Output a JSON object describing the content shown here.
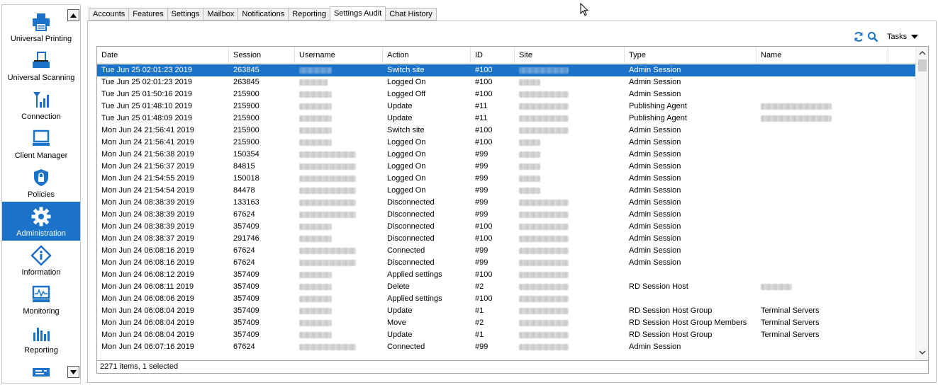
{
  "sidebar": {
    "items": [
      {
        "label": "Universal Printing",
        "icon": "printer-icon",
        "active": false
      },
      {
        "label": "Universal Scanning",
        "icon": "scanner-icon",
        "active": false
      },
      {
        "label": "Connection",
        "icon": "signal-icon",
        "active": false
      },
      {
        "label": "Client Manager",
        "icon": "monitor-icon",
        "active": false
      },
      {
        "label": "Policies",
        "icon": "shield-lock-icon",
        "active": false
      },
      {
        "label": "Administration",
        "icon": "gear-icon",
        "active": true
      },
      {
        "label": "Information",
        "icon": "info-diamond-icon",
        "active": false
      },
      {
        "label": "Monitoring",
        "icon": "monitoring-chart-icon",
        "active": false
      },
      {
        "label": "Reporting",
        "icon": "bar-chart-icon",
        "active": false
      }
    ],
    "accent": "#1a73c9",
    "icon_color": "#1a73c9"
  },
  "tabs": [
    {
      "label": "Accounts"
    },
    {
      "label": "Features"
    },
    {
      "label": "Settings"
    },
    {
      "label": "Mailbox"
    },
    {
      "label": "Notifications"
    },
    {
      "label": "Reporting"
    },
    {
      "label": "Settings Audit",
      "active": true
    },
    {
      "label": "Chat History"
    }
  ],
  "toolbar": {
    "refresh_icon": "refresh-icon",
    "search_icon": "search-icon",
    "tasks_label": "Tasks"
  },
  "grid": {
    "columns": [
      "Date",
      "Session",
      "Username",
      "Action",
      "ID",
      "Site",
      "Type",
      "Name"
    ],
    "rows": [
      {
        "date": "Tue Jun 25 02:01:23 2019",
        "session": "263845",
        "action": "Switch site",
        "id": "#100",
        "type": "Admin Session",
        "name": "",
        "selected": true
      },
      {
        "date": "Tue Jun 25 02:01:23 2019",
        "session": "263845",
        "action": "Logged On",
        "id": "#100",
        "type": "Admin Session",
        "name": ""
      },
      {
        "date": "Tue Jun 25 01:50:16 2019",
        "session": "215900",
        "action": "Logged Off",
        "id": "#100",
        "type": "Admin Session",
        "name": ""
      },
      {
        "date": "Tue Jun 25 01:48:10 2019",
        "session": "215900",
        "action": "Update",
        "id": "#11",
        "type": "Publishing Agent",
        "name": "",
        "name_redacted": true
      },
      {
        "date": "Tue Jun 25 01:48:09 2019",
        "session": "215900",
        "action": "Update",
        "id": "#11",
        "type": "Publishing Agent",
        "name": "",
        "name_redacted": true
      },
      {
        "date": "Mon Jun 24 21:56:41 2019",
        "session": "215900",
        "action": "Switch site",
        "id": "#100",
        "type": "Admin Session",
        "name": ""
      },
      {
        "date": "Mon Jun 24 21:56:41 2019",
        "session": "215900",
        "action": "Logged On",
        "id": "#100",
        "type": "Admin Session",
        "name": ""
      },
      {
        "date": "Mon Jun 24 21:56:38 2019",
        "session": "150354",
        "action": "Logged On",
        "id": "#99",
        "type": "Admin Session",
        "name": ""
      },
      {
        "date": "Mon Jun 24 21:56:37 2019",
        "session": "84815",
        "action": "Logged On",
        "id": "#99",
        "type": "Admin Session",
        "name": ""
      },
      {
        "date": "Mon Jun 24 21:54:55 2019",
        "session": "150018",
        "action": "Logged On",
        "id": "#99",
        "type": "Admin Session",
        "name": ""
      },
      {
        "date": "Mon Jun 24 21:54:54 2019",
        "session": "84478",
        "action": "Logged On",
        "id": "#99",
        "type": "Admin Session",
        "name": ""
      },
      {
        "date": "Mon Jun 24 08:38:39 2019",
        "session": "133163",
        "action": "Disconnected",
        "id": "#99",
        "type": "Admin Session",
        "name": ""
      },
      {
        "date": "Mon Jun 24 08:38:39 2019",
        "session": "67624",
        "action": "Disconnected",
        "id": "#99",
        "type": "Admin Session",
        "name": ""
      },
      {
        "date": "Mon Jun 24 08:38:39 2019",
        "session": "357409",
        "action": "Disconnected",
        "id": "#100",
        "type": "Admin Session",
        "name": ""
      },
      {
        "date": "Mon Jun 24 08:38:37 2019",
        "session": "291746",
        "action": "Disconnected",
        "id": "#100",
        "type": "Admin Session",
        "name": ""
      },
      {
        "date": "Mon Jun 24 06:08:16 2019",
        "session": "67624",
        "action": "Connected",
        "id": "#99",
        "type": "Admin Session",
        "name": ""
      },
      {
        "date": "Mon Jun 24 06:08:16 2019",
        "session": "67624",
        "action": "Disconnected",
        "id": "#99",
        "type": "Admin Session",
        "name": ""
      },
      {
        "date": "Mon Jun 24 06:08:12 2019",
        "session": "357409",
        "action": "Applied settings",
        "id": "#100",
        "type": "",
        "name": ""
      },
      {
        "date": "Mon Jun 24 06:08:11 2019",
        "session": "357409",
        "action": "Delete",
        "id": "#2",
        "type": "RD Session Host",
        "name": "",
        "name_redacted": true
      },
      {
        "date": "Mon Jun 24 06:08:06 2019",
        "session": "357409",
        "action": "Applied settings",
        "id": "#100",
        "type": "",
        "name": ""
      },
      {
        "date": "Mon Jun 24 06:08:04 2019",
        "session": "357409",
        "action": "Update",
        "id": "#1",
        "type": "RD Session Host Group",
        "name": "Terminal Servers"
      },
      {
        "date": "Mon Jun 24 06:08:04 2019",
        "session": "357409",
        "action": "Move",
        "id": "#2",
        "type": "RD Session Host Group Members",
        "name": "Terminal Servers"
      },
      {
        "date": "Mon Jun 24 06:08:04 2019",
        "session": "357409",
        "action": "Update",
        "id": "#1",
        "type": "RD Session Host Group",
        "name": "Terminal Servers"
      },
      {
        "date": "Mon Jun 24 06:07:16 2019",
        "session": "67624",
        "action": "Connected",
        "id": "#99",
        "type": "Admin Session",
        "name": ""
      }
    ]
  },
  "status": {
    "text": "2271 items, 1 selected"
  }
}
